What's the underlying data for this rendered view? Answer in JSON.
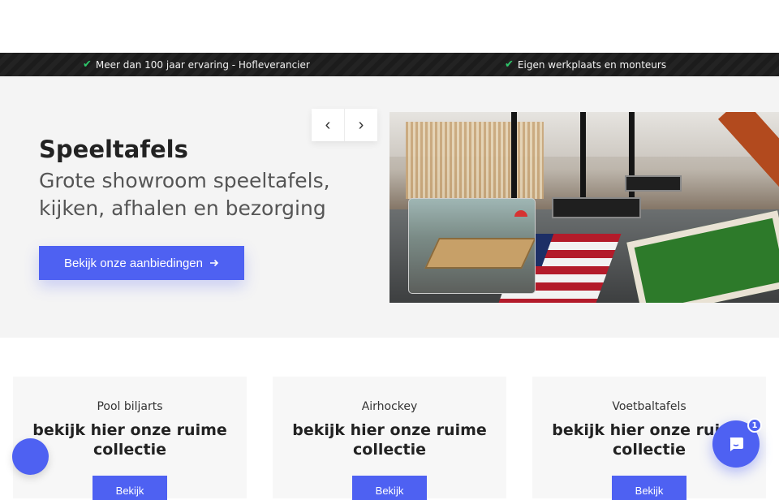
{
  "usp": {
    "items": [
      {
        "icon": "check-icon",
        "text": "Meer dan 100 jaar ervaring - Hofleverancier"
      },
      {
        "icon": "check-icon",
        "text": "Eigen werkplaats en monteurs"
      }
    ],
    "check_color": "#2ec86b"
  },
  "hero": {
    "title": "Speeltafels",
    "subtitle": "Grote showroom speeltafels, kijken, afhalen en bezorging",
    "cta_label": "Bekijk onze aanbiedingen",
    "cta_icon": "arrow-right-icon",
    "prev_label": "‹",
    "next_label": "›"
  },
  "categories": [
    {
      "name": "Pool biljarts",
      "title": "bekijk hier onze ruime collectie",
      "button": "Bekijk"
    },
    {
      "name": "Airhockey",
      "title": "bekijk hier onze ruime collectie",
      "button": "Bekijk"
    },
    {
      "name": "Voetbaltafels",
      "title": "bekijk hier onze ruime collectie",
      "button": "Bekijk"
    }
  ],
  "chat": {
    "badge_count": "1",
    "icon": "chat-bubble-icon"
  },
  "accessibility": {
    "icon": "accessibility-icon"
  },
  "colors": {
    "accent": "#4e61f2",
    "usp_background": "#1c1c1c",
    "hero_background": "#f4f4f4"
  }
}
